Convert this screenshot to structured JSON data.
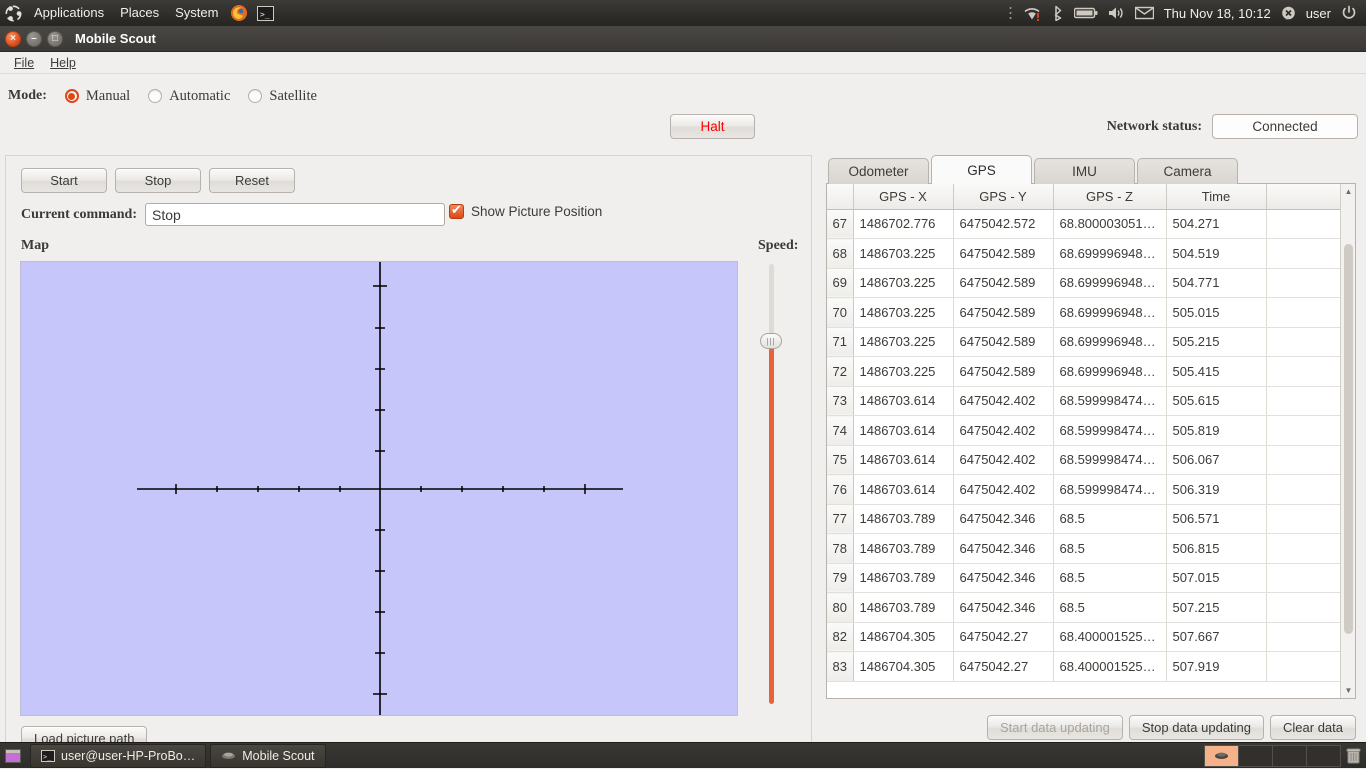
{
  "panel": {
    "logo_icon": "ubuntu-logo-icon",
    "menus": [
      "Applications",
      "Places",
      "System"
    ],
    "launchers": [
      "firefox-icon",
      "terminal-icon"
    ],
    "tray_icons": [
      "wifi-alert-icon",
      "bluetooth-icon",
      "battery-icon",
      "volume-icon",
      "mail-icon"
    ],
    "clock": "Thu Nov 18, 10:12",
    "user_icon": "user-status-icon",
    "username": "user",
    "power_icon": "power-icon"
  },
  "window": {
    "title": "Mobile Scout",
    "close_glyph": "×",
    "minimize_glyph": "–",
    "maximize_glyph": "□",
    "menu": [
      {
        "label": "File",
        "mnemonic": "F"
      },
      {
        "label": "Help",
        "mnemonic": "H"
      }
    ]
  },
  "controls": {
    "mode_label": "Mode:",
    "modes": [
      {
        "label": "Manual",
        "selected": true
      },
      {
        "label": "Automatic",
        "selected": false
      },
      {
        "label": "Satellite",
        "selected": false
      }
    ],
    "halt_label": "Halt",
    "halt_color": "#ff0000",
    "network_label": "Network status:",
    "network_value": "Connected"
  },
  "left_panel": {
    "buttons": [
      "Start",
      "Stop",
      "Reset"
    ],
    "command_label": "Current command:",
    "command_value": "Stop",
    "command_placeholder": "",
    "show_picture_label": "Show Picture Position",
    "show_picture_checked": true,
    "map_label": "Map",
    "map_bg_color": "#c6c6fa",
    "speed_label": "Speed:",
    "speed_fill_color": "#e8633a",
    "load_picture_label": "Load picture path"
  },
  "right_panel": {
    "tabs": [
      {
        "label": "Odometer",
        "active": false
      },
      {
        "label": "GPS",
        "active": true
      },
      {
        "label": "IMU",
        "active": false
      },
      {
        "label": "Camera",
        "active": false
      }
    ],
    "columns": [
      "",
      "GPS - X",
      "GPS - Y",
      "GPS - Z",
      "Time",
      ""
    ],
    "rows": [
      {
        "idx": "67",
        "x": "1486702.776",
        "y": "6475042.572",
        "z": "68.800003051…",
        "t": "504.271"
      },
      {
        "idx": "68",
        "x": "1486703.225",
        "y": "6475042.589",
        "z": "68.699996948…",
        "t": "504.519"
      },
      {
        "idx": "69",
        "x": "1486703.225",
        "y": "6475042.589",
        "z": "68.699996948…",
        "t": "504.771"
      },
      {
        "idx": "70",
        "x": "1486703.225",
        "y": "6475042.589",
        "z": "68.699996948…",
        "t": "505.015"
      },
      {
        "idx": "71",
        "x": "1486703.225",
        "y": "6475042.589",
        "z": "68.699996948…",
        "t": "505.215"
      },
      {
        "idx": "72",
        "x": "1486703.225",
        "y": "6475042.589",
        "z": "68.699996948…",
        "t": "505.415"
      },
      {
        "idx": "73",
        "x": "1486703.614",
        "y": "6475042.402",
        "z": "68.599998474…",
        "t": "505.615"
      },
      {
        "idx": "74",
        "x": "1486703.614",
        "y": "6475042.402",
        "z": "68.599998474…",
        "t": "505.819"
      },
      {
        "idx": "75",
        "x": "1486703.614",
        "y": "6475042.402",
        "z": "68.599998474…",
        "t": "506.067"
      },
      {
        "idx": "76",
        "x": "1486703.614",
        "y": "6475042.402",
        "z": "68.599998474…",
        "t": "506.319"
      },
      {
        "idx": "77",
        "x": "1486703.789",
        "y": "6475042.346",
        "z": "68.5",
        "t": "506.571"
      },
      {
        "idx": "78",
        "x": "1486703.789",
        "y": "6475042.346",
        "z": "68.5",
        "t": "506.815"
      },
      {
        "idx": "79",
        "x": "1486703.789",
        "y": "6475042.346",
        "z": "68.5",
        "t": "507.015"
      },
      {
        "idx": "80",
        "x": "1486703.789",
        "y": "6475042.346",
        "z": "68.5",
        "t": "507.215"
      },
      {
        "idx": "82",
        "x": "1486704.305",
        "y": "6475042.27",
        "z": "68.400001525…",
        "t": "507.667"
      },
      {
        "idx": "83",
        "x": "1486704.305",
        "y": "6475042.27",
        "z": "68.400001525…",
        "t": "507.919"
      }
    ],
    "footer_buttons": [
      {
        "label": "Start data updating",
        "enabled": false
      },
      {
        "label": "Stop data updating",
        "enabled": true
      },
      {
        "label": "Clear data",
        "enabled": true
      }
    ]
  },
  "taskbar": {
    "show_desktop_icon": "show-desktop-icon",
    "items": [
      {
        "icon": "terminal-icon",
        "label": "user@user-HP-ProBo…"
      },
      {
        "icon": "mobile-scout-icon",
        "label": "Mobile Scout"
      }
    ],
    "workspaces": 4,
    "active_workspace": 1,
    "trash_icon": "trash-icon"
  }
}
